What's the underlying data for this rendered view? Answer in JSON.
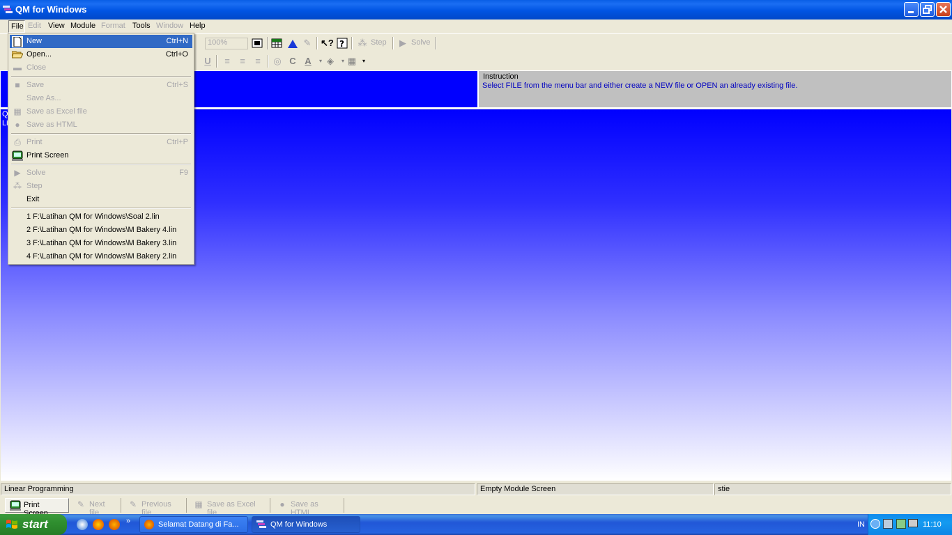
{
  "window": {
    "title": "QM for Windows"
  },
  "menubar": {
    "file": "File",
    "edit": "Edit",
    "view": "View",
    "module": "Module",
    "format": "Format",
    "tools": "Tools",
    "window": "Window",
    "help": "Help"
  },
  "toolbar": {
    "zoom": "100%",
    "step": "Step",
    "solve": "Solve"
  },
  "instruction": {
    "title": "Instruction",
    "text": "Select FILE from the menu bar and either create a NEW file or OPEN an already existing file."
  },
  "main": {
    "label_line1": "Q",
    "label_line2": "Li"
  },
  "file_menu": {
    "new": {
      "label": "New",
      "shortcut": "Ctrl+N"
    },
    "open": {
      "label": "Open...",
      "shortcut": "Ctrl+O"
    },
    "close": {
      "label": "Close"
    },
    "save": {
      "label": "Save",
      "shortcut": "Ctrl+S"
    },
    "save_as": {
      "label": "Save As..."
    },
    "save_excel": {
      "label": "Save as Excel file"
    },
    "save_html": {
      "label": "Save as HTML"
    },
    "print": {
      "label": "Print",
      "shortcut": "Ctrl+P"
    },
    "print_screen": {
      "label": "Print Screen"
    },
    "solve": {
      "label": "Solve",
      "shortcut": "F9"
    },
    "step": {
      "label": "Step"
    },
    "exit": {
      "label": "Exit"
    },
    "recent": [
      "1 F:\\Latihan QM for Windows\\Soal 2.lin",
      "2 F:\\Latihan QM for Windows\\M Bakery 4.lin",
      "3 F:\\Latihan QM for Windows\\M Bakery 3.lin",
      "4 F:\\Latihan QM for Windows\\M Bakery 2.lin"
    ]
  },
  "status": {
    "module": "Linear Programming",
    "screen": "Empty Module Screen",
    "user": "stie"
  },
  "bottom_toolbar": {
    "print_screen": "Print Screen",
    "next_file": "Next file",
    "previous_file": "Previous file",
    "save_excel": "Save as Excel file",
    "save_html": "Save as HTML"
  },
  "taskbar": {
    "start": "start",
    "tasks": [
      "Selamat Datang di Fa...",
      "QM for Windows"
    ],
    "language": "IN",
    "clock": "11:10"
  }
}
